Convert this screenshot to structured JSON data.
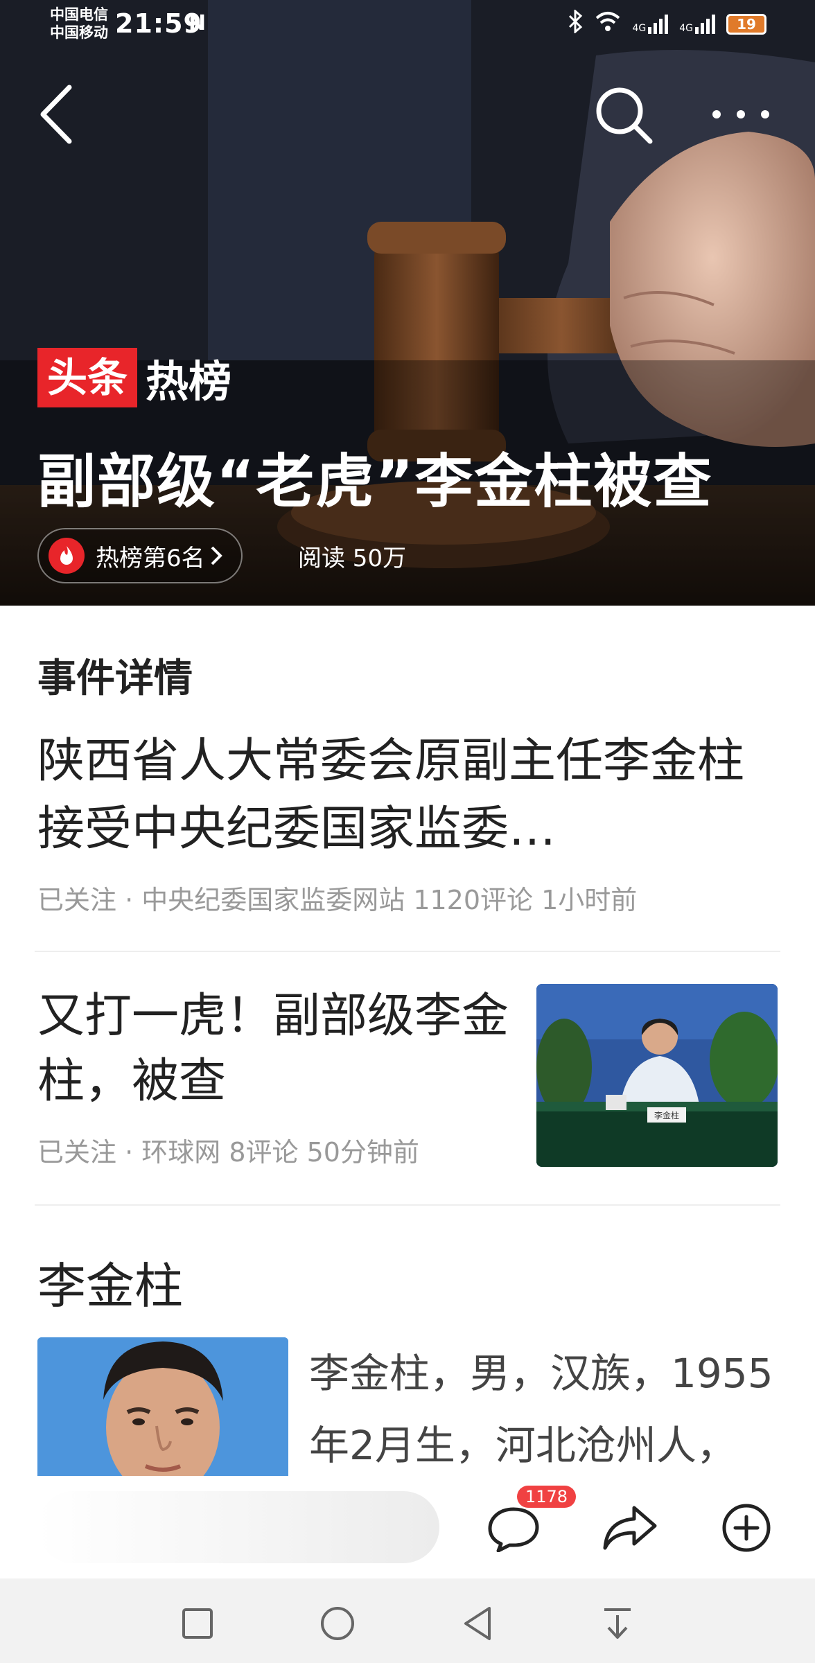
{
  "status_bar": {
    "carrier1": "中国电信",
    "carrier2": "中国移动",
    "time": "21:59",
    "nfc": "N",
    "net1": "4G",
    "net2": "4G",
    "battery": "19"
  },
  "hero": {
    "brand_red": "头条",
    "brand_white": "热榜",
    "title": "副部级“老虎”李金柱被查",
    "rank": "热榜第6名",
    "reads": "阅读 50万"
  },
  "section": {
    "title": "事件详情"
  },
  "articles": [
    {
      "title": "陕西省人大常委会原副主任李金柱接受中央纪委国家监委…",
      "meta": "已关注 · 中央纪委国家监委网站  1120评论  1小时前"
    },
    {
      "title": "又打一虎！副部级李金柱，被查",
      "meta": "已关注 · 环球网  8评论  50分钟前",
      "thumb_label": "李金柱"
    }
  ],
  "person": {
    "name": "李金柱",
    "bio": "李金柱，男，汉族，1955年2月生，河北沧州人，"
  },
  "bottom_bar": {
    "comment_count": "1178",
    "icons": [
      "comment-icon",
      "share-icon",
      "add-icon"
    ]
  },
  "colors": {
    "brand_red": "#e8252a",
    "badge_red": "#f04142",
    "meta_gray": "#999999"
  }
}
